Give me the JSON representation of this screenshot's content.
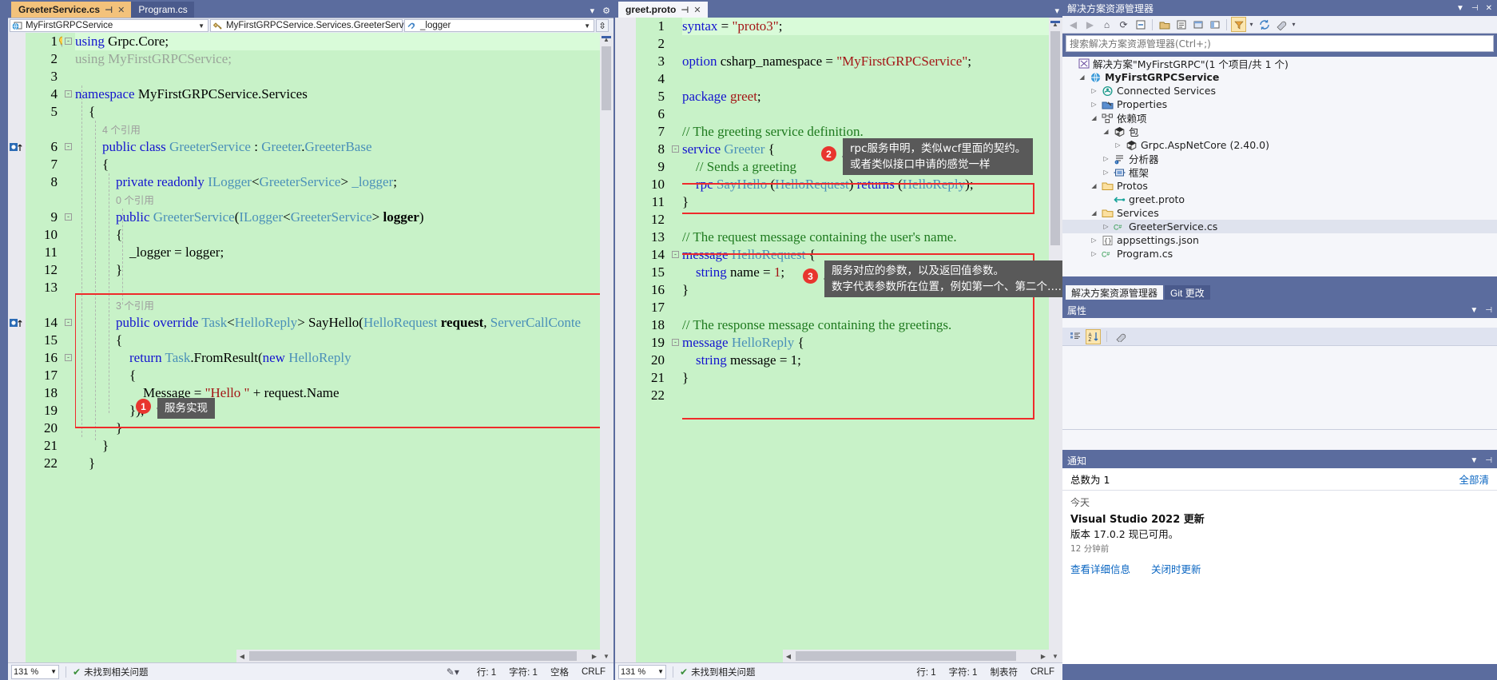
{
  "window": {
    "accent": "#5b6c9e",
    "editor_bg": "#c8f2c8",
    "highlight_red": "#ef2b2b"
  },
  "left_pane": {
    "tabs": [
      {
        "label": "GreeterService.cs",
        "active": true,
        "pin": "⊣",
        "close": "✕"
      },
      {
        "label": "Program.cs",
        "active": false,
        "pin": "",
        "close": ""
      }
    ],
    "nav": {
      "project": "MyFirstGRPCService",
      "type": "MyFirstGRPCService.Services.GreeterService",
      "member": "_logger",
      "project_icon": "globe-icon",
      "type_icon": "class-icon",
      "member_icon": "field-icon"
    },
    "lines": [
      {
        "n": "1",
        "ind": 0,
        "fold": "-",
        "html": "<span class='kw'>using</span> Grpc.Core;",
        "bulb": true,
        "current": true
      },
      {
        "n": "2",
        "ind": 0,
        "fold": "",
        "html": "<span class='gray'>using MyFirstGRPCService;</span>"
      },
      {
        "n": "3",
        "ind": 0,
        "fold": "",
        "html": ""
      },
      {
        "n": "4",
        "ind": 0,
        "fold": "-",
        "html": "<span class='kw'>namespace</span> MyFirstGRPCService.Services"
      },
      {
        "n": "5",
        "ind": 1,
        "fold": "",
        "html": "{"
      },
      {
        "n": "",
        "ind": 2,
        "fold": "",
        "html": "<span class='ref'>4 个引用</span>",
        "ref": true
      },
      {
        "n": "6",
        "ind": 2,
        "fold": "-",
        "html": "<span class='kw'>public class</span> <span class='ty'>GreeterService</span> : <span class='ty'>Greeter</span>.<span class='ty'>GreeterBase</span>",
        "marker": true
      },
      {
        "n": "7",
        "ind": 2,
        "fold": "",
        "html": "{"
      },
      {
        "n": "8",
        "ind": 3,
        "fold": "",
        "html": "<span class='kw'>private readonly</span> <span class='ty'>ILogger</span>&lt;<span class='ty'>GreeterService</span>&gt; <span class='ty'>_logger</span>;"
      },
      {
        "n": "",
        "ind": 3,
        "fold": "",
        "html": "<span class='ref'>0 个引用</span>",
        "ref": true
      },
      {
        "n": "9",
        "ind": 3,
        "fold": "-",
        "html": "<span class='kw'>public</span> <span class='ty'>GreeterService</span>(<span class='ty'>ILogger</span>&lt;<span class='ty'>GreeterService</span>&gt; <span class='bold'>logger</span>)"
      },
      {
        "n": "10",
        "ind": 3,
        "fold": "",
        "html": "{"
      },
      {
        "n": "11",
        "ind": 4,
        "fold": "",
        "html": "_logger = logger;"
      },
      {
        "n": "12",
        "ind": 3,
        "fold": "",
        "html": "}"
      },
      {
        "n": "13",
        "ind": 3,
        "fold": "",
        "html": ""
      },
      {
        "n": "",
        "ind": 3,
        "fold": "",
        "html": "<span class='ref'>3 个引用</span>",
        "ref": true
      },
      {
        "n": "14",
        "ind": 3,
        "fold": "-",
        "html": "<span class='kw'>public override</span> <span class='ty'>Task</span>&lt;<span class='ty'>HelloReply</span>&gt; SayHello(<span class='ty'>HelloRequest</span> <span class='bold'>request</span>, <span class='ty'>ServerCallConte</span>",
        "marker": true
      },
      {
        "n": "15",
        "ind": 3,
        "fold": "",
        "html": "{"
      },
      {
        "n": "16",
        "ind": 4,
        "fold": "-",
        "html": "<span class='kw'>return</span> <span class='ty'>Task</span>.FromResult(<span class='kw'>new</span> <span class='ty'>HelloReply</span>"
      },
      {
        "n": "17",
        "ind": 4,
        "fold": "",
        "html": "{"
      },
      {
        "n": "18",
        "ind": 5,
        "fold": "",
        "html": "Message = <span class='str'>\"Hello \"</span> + request.Name"
      },
      {
        "n": "19",
        "ind": 4,
        "fold": "",
        "html": "});"
      },
      {
        "n": "20",
        "ind": 3,
        "fold": "",
        "html": "}"
      },
      {
        "n": "21",
        "ind": 2,
        "fold": "",
        "html": "}"
      },
      {
        "n": "22",
        "ind": 1,
        "fold": "",
        "html": "}"
      }
    ],
    "callout": {
      "number": "1",
      "text": "服务实现"
    },
    "status": {
      "zoom": "131 %",
      "issues": "未找到相关问题",
      "line_label": "行: 1",
      "col_label": "字符: 1",
      "space_label": "空格",
      "eol_label": "CRLF"
    }
  },
  "right_pane": {
    "tabs": [
      {
        "label": "greet.proto",
        "active": true,
        "pin": "⊣",
        "close": "✕"
      }
    ],
    "lines": [
      {
        "n": "1",
        "ind": 0,
        "fold": "",
        "html": "<span class='kw'>syntax</span> = <span class='str'>\"proto3\"</span>;",
        "current": true
      },
      {
        "n": "2",
        "ind": 0,
        "fold": "",
        "html": ""
      },
      {
        "n": "3",
        "ind": 0,
        "fold": "",
        "html": "<span class='kw'>option</span> csharp_namespace = <span class='str'>\"MyFirstGRPCService\"</span>;"
      },
      {
        "n": "4",
        "ind": 0,
        "fold": "",
        "html": ""
      },
      {
        "n": "5",
        "ind": 0,
        "fold": "",
        "html": "<span class='kw'>package</span> <span class='str'>greet</span>;"
      },
      {
        "n": "6",
        "ind": 0,
        "fold": "",
        "html": ""
      },
      {
        "n": "7",
        "ind": 0,
        "fold": "",
        "html": "<span class='cmt'>// The greeting service definition.</span>"
      },
      {
        "n": "8",
        "ind": 0,
        "fold": "-",
        "html": "<span class='kw'>service</span> <span class='ty'>Greeter</span> {"
      },
      {
        "n": "9",
        "ind": 1,
        "fold": "",
        "html": "<span class='cmt'>// Sends a greeting</span>"
      },
      {
        "n": "10",
        "ind": 1,
        "fold": "",
        "html": "<span class='kw'>rpc</span> <span class='ty'>SayHello</span> (<span class='ty'>HelloRequest</span>) <span class='kw'>returns</span> (<span class='ty'>HelloReply</span>);"
      },
      {
        "n": "11",
        "ind": 0,
        "fold": "",
        "html": "}"
      },
      {
        "n": "12",
        "ind": 0,
        "fold": "",
        "html": ""
      },
      {
        "n": "13",
        "ind": 0,
        "fold": "",
        "html": "<span class='cmt'>// The request message containing the user's name.</span>"
      },
      {
        "n": "14",
        "ind": 0,
        "fold": "-",
        "html": "<span class='kw'>message</span> <span class='ty'>HelloRequest</span> {"
      },
      {
        "n": "15",
        "ind": 1,
        "fold": "",
        "html": "<span class='kw'>string</span> name = <span class='str'>1</span>;"
      },
      {
        "n": "16",
        "ind": 0,
        "fold": "",
        "html": "}"
      },
      {
        "n": "17",
        "ind": 0,
        "fold": "",
        "html": ""
      },
      {
        "n": "18",
        "ind": 0,
        "fold": "",
        "html": "<span class='cmt'>// The response message containing the greetings.</span>"
      },
      {
        "n": "19",
        "ind": 0,
        "fold": "-",
        "html": "<span class='kw'>message</span> <span class='ty'>HelloReply</span> {"
      },
      {
        "n": "20",
        "ind": 1,
        "fold": "",
        "html": "<span class='kw'>string</span> message = 1;"
      },
      {
        "n": "21",
        "ind": 0,
        "fold": "",
        "html": "}"
      },
      {
        "n": "22",
        "ind": 0,
        "fold": "",
        "html": ""
      }
    ],
    "callouts": [
      {
        "number": "2",
        "line1": "rpc服务申明，类似wcf里面的契约。",
        "line2": "或者类似接口申请的感觉一样"
      },
      {
        "number": "3",
        "line1": "服务对应的参数，以及返回值参数。",
        "line2": "数字代表参数所在位置，例如第一个、第二个……"
      }
    ],
    "status": {
      "zoom": "131 %",
      "issues": "未找到相关问题",
      "line_label": "行: 1",
      "col_label": "字符: 1",
      "space_label": "制表符",
      "eol_label": "CRLF"
    }
  },
  "solution_explorer": {
    "title": "解决方案资源管理器",
    "search_placeholder": "搜索解决方案资源管理器(Ctrl+;)",
    "toolbar_icons": [
      "back-icon",
      "forward-icon",
      "home-icon",
      "refresh-icon",
      "collapse-all-icon",
      "show-all-files-icon",
      "properties-icon",
      "preview-icon",
      "pending-changes-icon",
      "filter-icon",
      "sync-icon",
      "wrench-icon"
    ],
    "solution_label": "解决方案\"MyFirstGRPC\"(1 个项目/共 1 个)",
    "nodes": [
      {
        "label": "MyFirstGRPCService",
        "depth": 1,
        "twisty": "▲",
        "icon": "project-globe-icon",
        "bold": true
      },
      {
        "label": "Connected Services",
        "depth": 2,
        "twisty": "▷",
        "icon": "connected-services-icon"
      },
      {
        "label": "Properties",
        "depth": 2,
        "twisty": "▷",
        "icon": "properties-wrench-icon"
      },
      {
        "label": "依赖项",
        "depth": 2,
        "twisty": "▲",
        "icon": "dependencies-icon"
      },
      {
        "label": "包",
        "depth": 3,
        "twisty": "▲",
        "icon": "package-icon"
      },
      {
        "label": "Grpc.AspNetCore (2.40.0)",
        "depth": 4,
        "twisty": "▷",
        "icon": "package-icon"
      },
      {
        "label": "分析器",
        "depth": 3,
        "twisty": "▷",
        "icon": "analyzer-icon"
      },
      {
        "label": "框架",
        "depth": 3,
        "twisty": "▷",
        "icon": "framework-icon"
      },
      {
        "label": "Protos",
        "depth": 2,
        "twisty": "▲",
        "icon": "folder-icon"
      },
      {
        "label": "greet.proto",
        "depth": 3,
        "twisty": "",
        "icon": "proto-icon"
      },
      {
        "label": "Services",
        "depth": 2,
        "twisty": "▲",
        "icon": "folder-icon"
      },
      {
        "label": "GreeterService.cs",
        "depth": 3,
        "twisty": "▷",
        "icon": "csharp-icon",
        "selected": true
      },
      {
        "label": "appsettings.json",
        "depth": 2,
        "twisty": "▷",
        "icon": "json-icon"
      },
      {
        "label": "Program.cs",
        "depth": 2,
        "twisty": "▷",
        "icon": "csharp-icon"
      }
    ],
    "bottom_tabs": [
      {
        "label": "解决方案资源管理器",
        "active": true
      },
      {
        "label": "Git 更改",
        "active": false
      }
    ]
  },
  "properties_panel": {
    "title": "属性",
    "toolbar_icons": [
      "categorized-icon",
      "alphabetical-icon",
      "property-pages-icon"
    ]
  },
  "notifications": {
    "title": "通知",
    "count_label": "总数为 1",
    "clear_all_label": "全部清",
    "group_label": "今天",
    "item_title": "Visual Studio 2022 更新",
    "item_desc": "版本 17.0.2 现已可用。",
    "item_age": "12 分钟前",
    "action_details": "查看详细信息",
    "action_update": "关闭时更新"
  }
}
